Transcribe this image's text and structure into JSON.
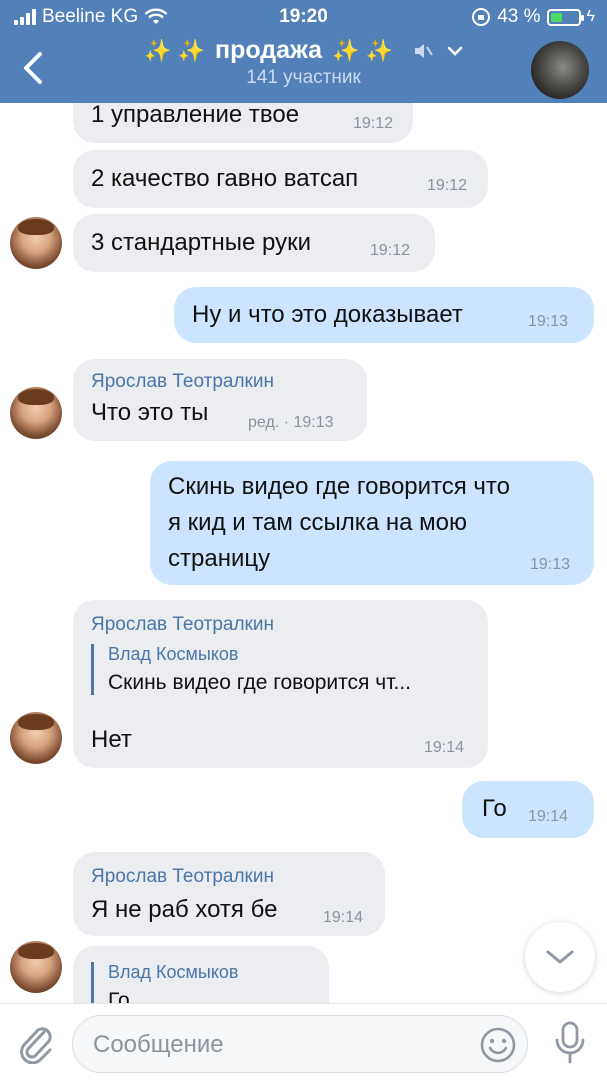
{
  "status_bar": {
    "carrier": "Beeline KG",
    "time": "19:20",
    "battery_pct": "43 %",
    "battery_level": 0.43
  },
  "header": {
    "title": "продажа",
    "subtitle": "141 участник",
    "sparkle": "✨ ✨"
  },
  "messages": [
    {
      "text": "1 управление твое",
      "time": "19:12"
    },
    {
      "text": "2 качество гавно ватсап",
      "time": "19:12"
    },
    {
      "text": "3 стандартные руки",
      "time": "19:12"
    },
    {
      "text": "Ну и что это доказывает",
      "time": "19:13"
    },
    {
      "sender": "Ярослав Теотралкин",
      "text": "Что это ты",
      "time": "ред. · 19:13"
    },
    {
      "text_lines": [
        "Скинь видео где говорится что",
        "я кид и там ссылка на мою",
        "страницу"
      ],
      "time": "19:13"
    },
    {
      "sender": "Ярослав Теотралкин",
      "reply_name": "Влад Космыков",
      "reply_text": "Скинь видео где говорится чт...",
      "text": "Нет",
      "time": "19:14"
    },
    {
      "text": "Го",
      "time": "19:14"
    },
    {
      "sender": "Ярослав Теотралкин",
      "text": "Я не раб хотя бе",
      "time": "19:14"
    },
    {
      "reply_name": "Влад Космыков",
      "reply_text": "Го"
    }
  ],
  "composer": {
    "placeholder": "Сообщение"
  },
  "colors": {
    "header_bg": "#5181b8",
    "incoming_bubble": "#ebedf0",
    "outgoing_bubble": "#cce4ff",
    "link": "#4a76a8"
  }
}
